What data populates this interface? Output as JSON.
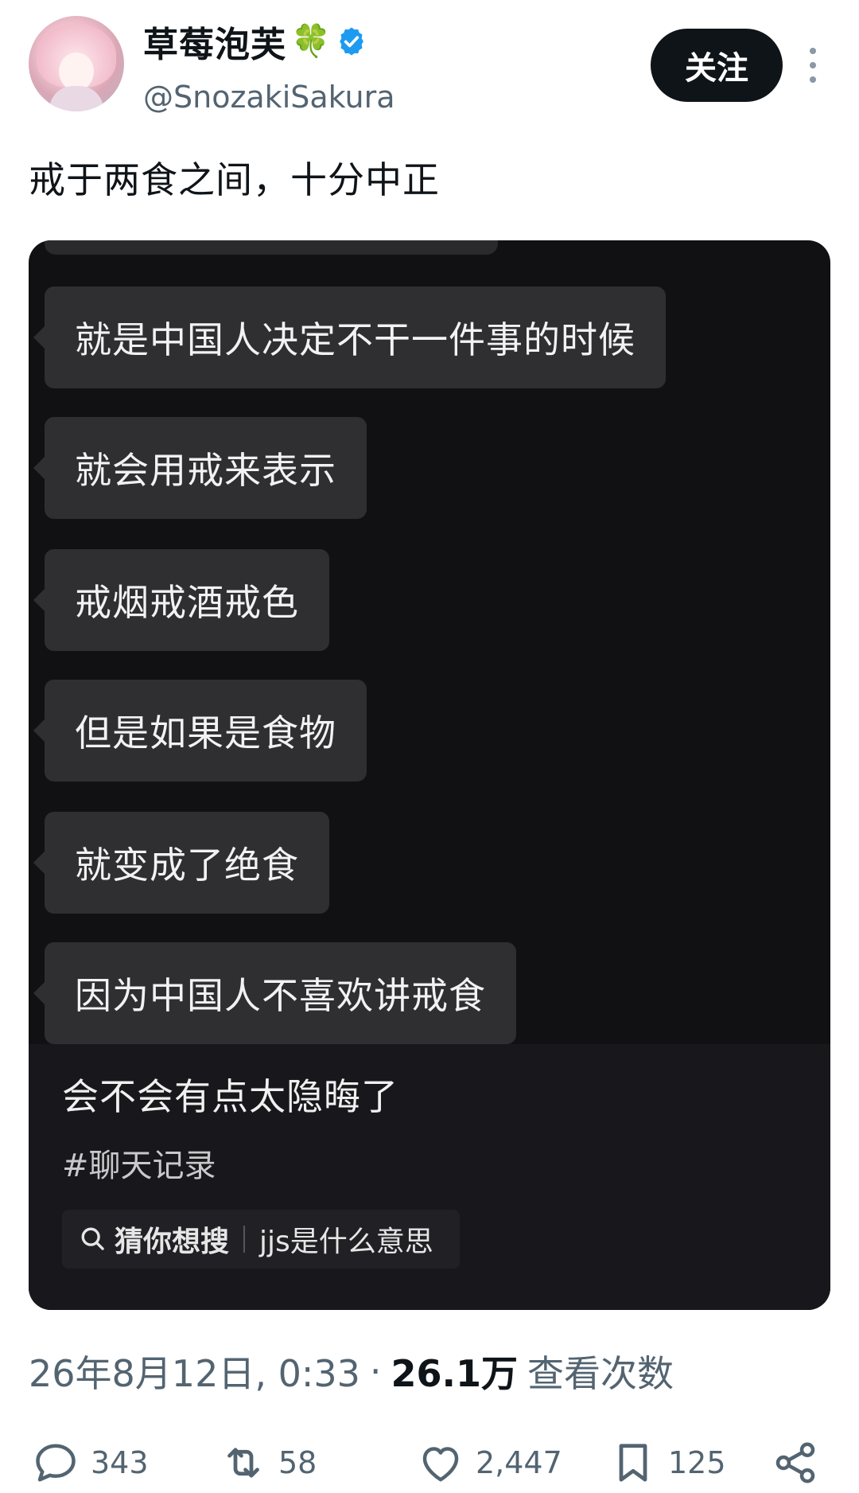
{
  "author": {
    "display_name": "草莓泡芙",
    "emoji": "🍀",
    "handle": "@SnozakiSakura"
  },
  "follow_label": "关注",
  "tweet_text": "戒于两食之间，十分中正",
  "media": {
    "messages": [
      "就是中国人决定不干一件事的时候",
      "就会用戒来表示",
      "戒烟戒酒戒色",
      "但是如果是食物",
      "就变成了绝食",
      "因为中国人不喜欢讲戒食"
    ],
    "caption": "会不会有点太隐晦了",
    "hashtag": "#聊天记录",
    "search_suggest": {
      "label": "猜你想搜",
      "query": "jjs是什么意思"
    }
  },
  "meta": {
    "timestamp": "26年8月12日, 0:33",
    "separator": "·",
    "views_count": "26.1万",
    "views_label": "查看次数"
  },
  "actions": {
    "replies": "343",
    "retweets": "58",
    "likes": "2,447",
    "bookmarks": "125"
  },
  "colors": {
    "verified": "#1d9bf0",
    "clover": "#3aa24a",
    "follow_bg": "#0f1419",
    "secondary_text": "#536471",
    "media_bg": "#111113",
    "bubble_bg": "#2f2f32"
  }
}
